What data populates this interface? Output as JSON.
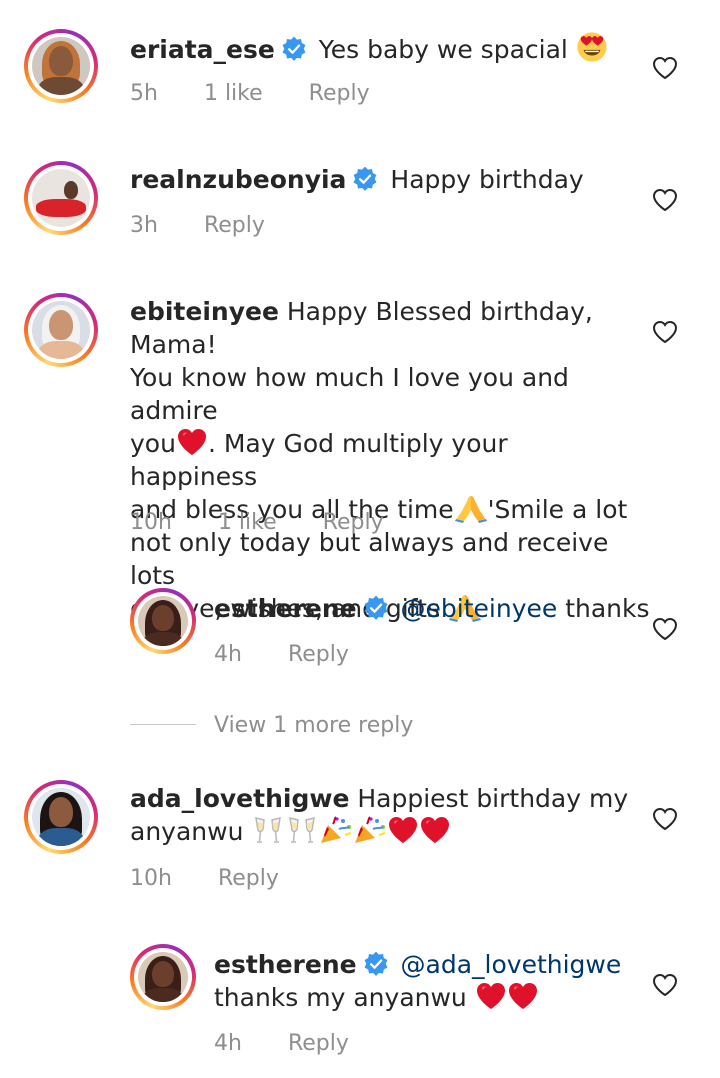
{
  "comments": [
    {
      "username": "eriata_ese",
      "verified": true,
      "text": "Yes baby we spacial",
      "emoji": "smiling-face-with-heart-eyes",
      "time": "5h",
      "likes": "1 like",
      "reply_label": "Reply"
    },
    {
      "username": "realnzubeonyia",
      "verified": true,
      "text": "Happy birthday",
      "time": "3h",
      "reply_label": "Reply"
    },
    {
      "username": "ebiteinyee",
      "verified": false,
      "line1": "Happy Blessed birthday, Mama!",
      "line2": "You know how much I love you and admire",
      "line3a": "you",
      "line3b": ". May God multiply your happiness",
      "line4a": "and bless you all the time",
      "line4b": "'Smile a lot",
      "line5": "not only today but always and receive lots",
      "line6": "of love, wishes, and gifts",
      "time": "10h",
      "likes": "1 like",
      "reply_label": "Reply"
    },
    {
      "username": "ada_lovethigwe",
      "verified": false,
      "line1": "Happiest birthday my",
      "line2": "anyanwu",
      "time": "10h",
      "reply_label": "Reply"
    }
  ],
  "replies": [
    {
      "username": "estherene",
      "verified": true,
      "mention": "@ebiteinyee",
      "text": "thanks",
      "time": "4h",
      "reply_label": "Reply"
    },
    {
      "username": "estherene",
      "verified": true,
      "mention": "@ada_lovethigwe",
      "line2": "thanks my anyanwu",
      "time": "4h",
      "reply_label": "Reply"
    }
  ],
  "view_more_label": "View 1 more reply",
  "colors": {
    "text": "#262626",
    "meta": "#8e8e8e",
    "mention": "#00376b",
    "verified_blue": "#3897f0",
    "heart_red": "#e0112b"
  }
}
